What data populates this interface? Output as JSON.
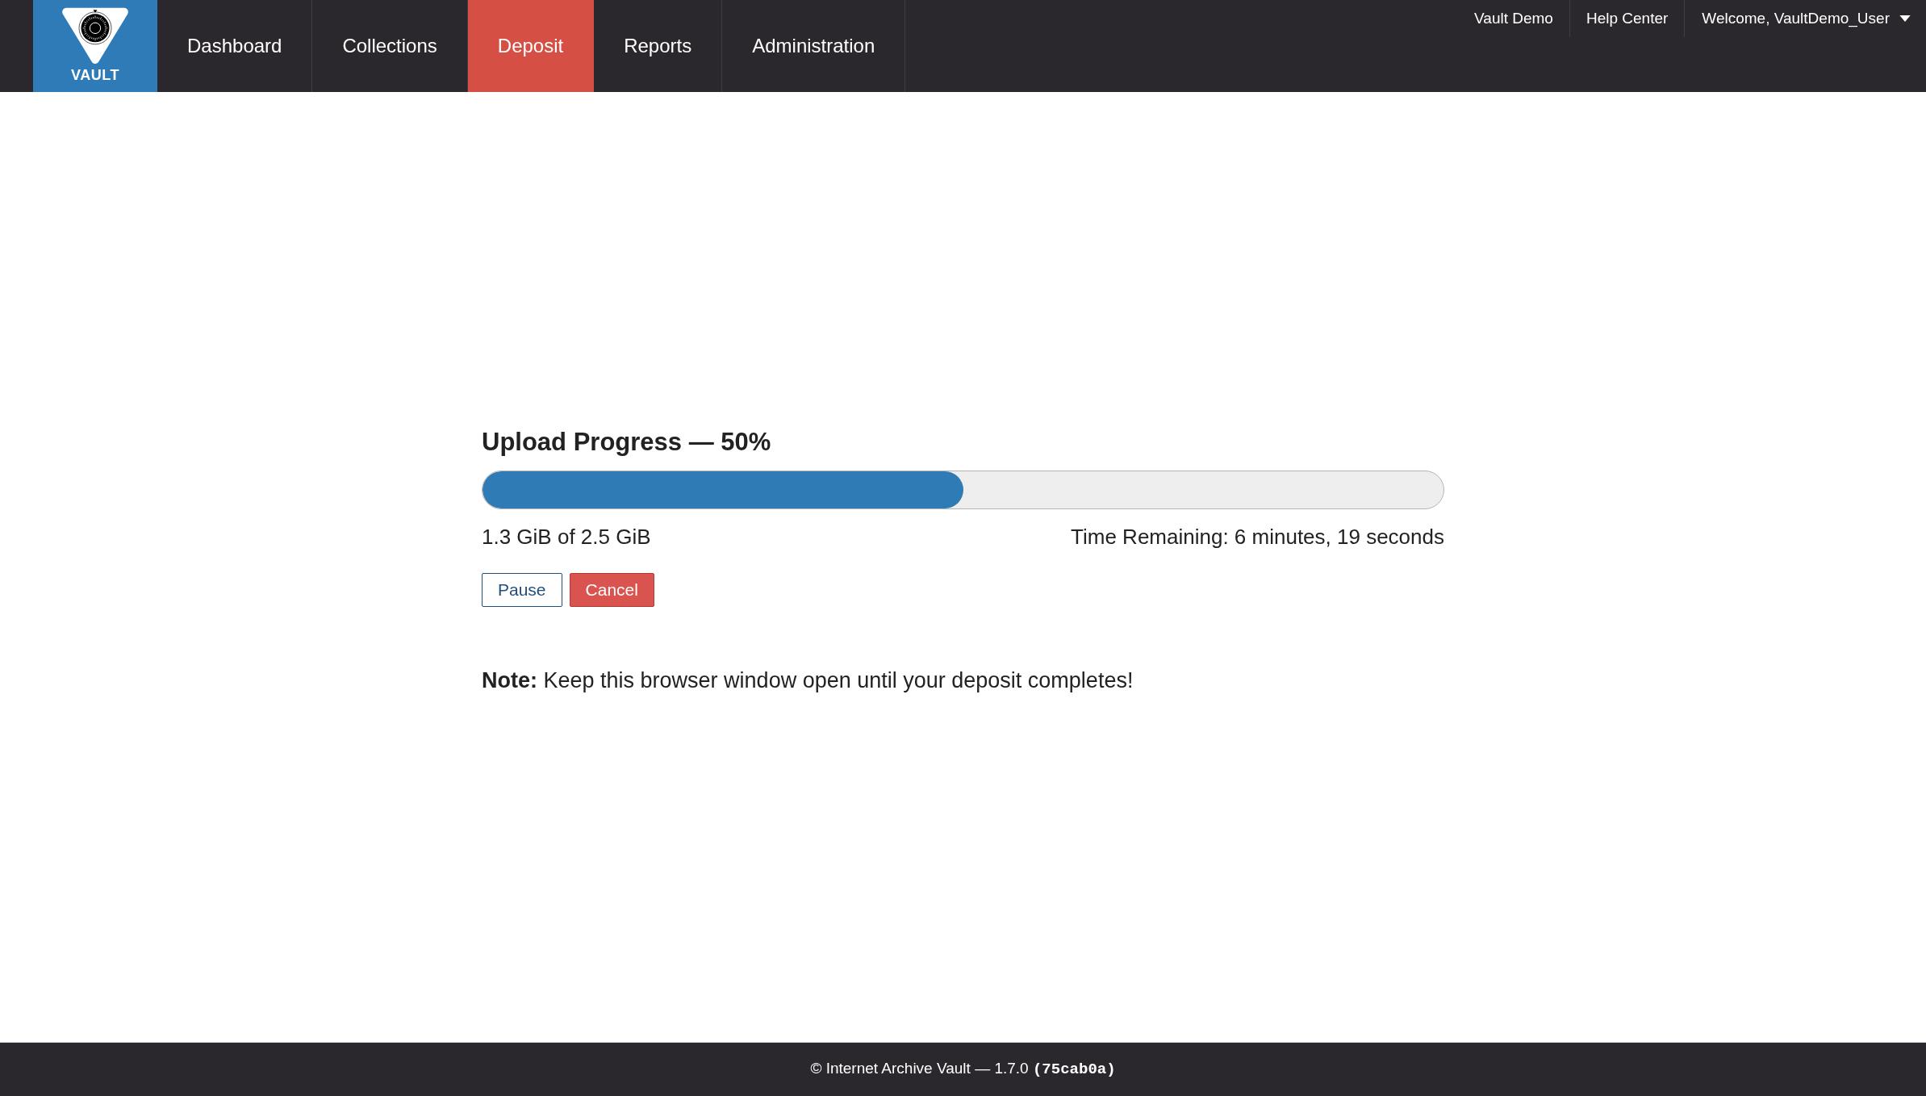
{
  "header": {
    "logo_text": "VAULT",
    "nav": [
      {
        "label": "Dashboard",
        "selected": false
      },
      {
        "label": "Collections",
        "selected": false
      },
      {
        "label": "Deposit",
        "selected": true
      },
      {
        "label": "Reports",
        "selected": false
      },
      {
        "label": "Administration",
        "selected": false
      }
    ],
    "links": [
      {
        "label": "Vault Demo"
      },
      {
        "label": "Help Center"
      }
    ],
    "user_menu": {
      "label": "Welcome, VaultDemo_User"
    }
  },
  "upload": {
    "title": "Upload Progress — 50%",
    "level": 0.5,
    "transferred": "1.3 GiB of 2.5 GiB",
    "time_remaining": "Time Remaining: 6 minutes, 19 seconds",
    "buttons": [
      {
        "label": "Pause",
        "kind": "outline"
      },
      {
        "label": "Cancel",
        "kind": "danger"
      }
    ],
    "note": "**Note:** Keep this browser window open until your deposit completes!"
  },
  "footer": {
    "text": "© Internet Archive Vault — 1.7.0",
    "build": "(75cab0a)"
  }
}
